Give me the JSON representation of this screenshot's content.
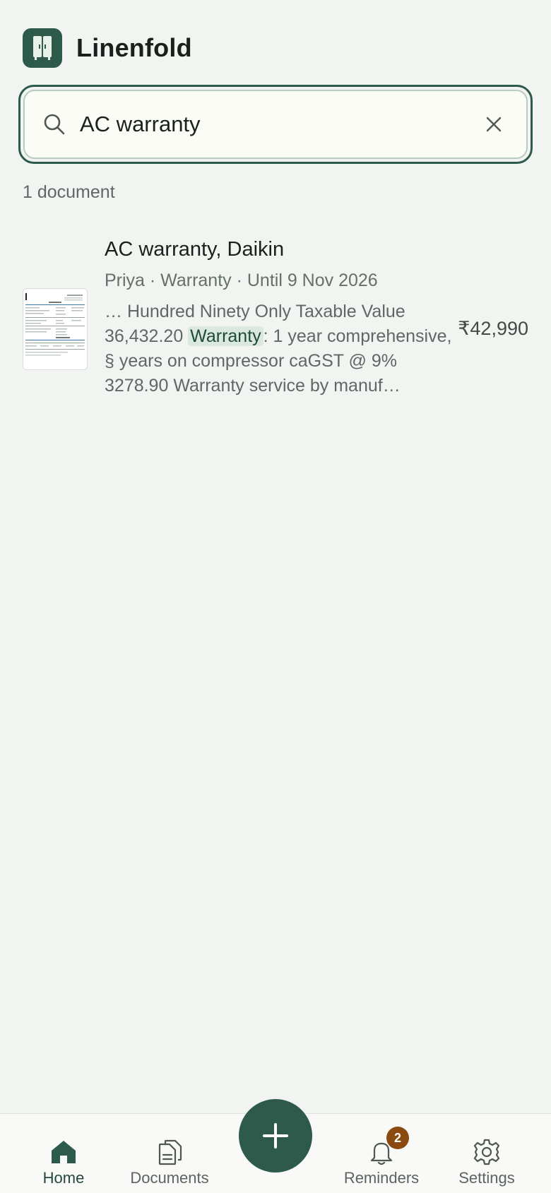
{
  "app": {
    "title": "Linenfold",
    "accent_color": "#2e5a4b",
    "logo_icon": "wardrobe-icon"
  },
  "search": {
    "value": "AC warranty",
    "icon": "search-icon",
    "clear_icon": "close-icon"
  },
  "results": {
    "count_label": "1 document",
    "items": [
      {
        "title": "AC warranty, Daikin",
        "meta": "Priya · Warranty · Until 9 Nov 2026",
        "snippet_before": "… Hundred Ninety Only Taxable Value 36,432.20 ",
        "snippet_highlight": "Warranty",
        "snippet_after": ": 1 year comprehensive, § years on compressor caGST @ 9% 3278.90 Warranty service by manuf…",
        "amount": "₹42,990",
        "thumbnail_icon": "invoice-thumbnail"
      }
    ]
  },
  "nav": {
    "items": [
      {
        "label": "Home",
        "icon": "home-icon",
        "active": true
      },
      {
        "label": "Documents",
        "icon": "documents-icon",
        "active": false
      },
      {
        "label": "Reminders",
        "icon": "bell-icon",
        "active": false,
        "badge": "2"
      },
      {
        "label": "Settings",
        "icon": "gear-icon",
        "active": false
      }
    ],
    "fab_icon": "plus-icon"
  }
}
